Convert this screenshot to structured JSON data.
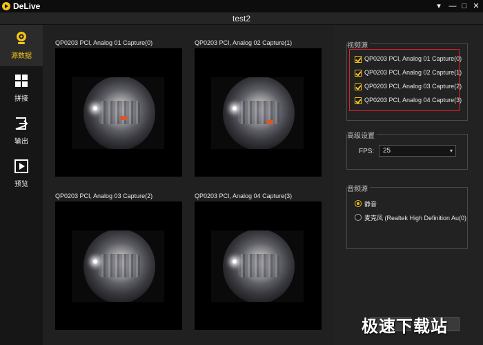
{
  "app": {
    "name": "DeLive"
  },
  "window": {
    "controls": [
      "▾",
      "—",
      "□",
      "✕"
    ]
  },
  "project": {
    "title": "test2"
  },
  "sidebar": {
    "items": [
      {
        "label": "源数据",
        "icon": "webcam-icon",
        "active": true
      },
      {
        "label": "拼接",
        "icon": "grid-icon",
        "active": false
      },
      {
        "label": "输出",
        "icon": "export-icon",
        "active": false
      },
      {
        "label": "预览",
        "icon": "play-icon",
        "active": false
      }
    ]
  },
  "captures": [
    {
      "label": "QP0203 PCI, Analog 01 Capture(0)"
    },
    {
      "label": "QP0203 PCI, Analog 02 Capture(1)"
    },
    {
      "label": "QP0203 PCI, Analog 03 Capture(2)"
    },
    {
      "label": "QP0203 PCI, Analog 04 Capture(3)"
    }
  ],
  "video_source": {
    "title": "视频源",
    "items": [
      {
        "label": "QP0203 PCI, Analog 01 Capture(0)",
        "checked": true
      },
      {
        "label": "QP0203 PCI, Analog 02 Capture(1)",
        "checked": true
      },
      {
        "label": "QP0203 PCI, Analog 03 Capture(2)",
        "checked": true
      },
      {
        "label": "QP0203 PCI, Analog 04 Capture(3)",
        "checked": true
      }
    ]
  },
  "advanced": {
    "title": "高级设置",
    "fps_label": "FPS:",
    "fps_value": "25"
  },
  "audio_source": {
    "title": "音频源",
    "items": [
      {
        "label": "静音",
        "selected": true
      },
      {
        "label": "麦克风 (Realtek High Definition Au(0)",
        "selected": false
      }
    ]
  },
  "watermark": {
    "text": "极速下载站"
  },
  "colors": {
    "accent": "#f2c21b",
    "highlight": "#e0202a",
    "background": "#1c1c1c"
  }
}
